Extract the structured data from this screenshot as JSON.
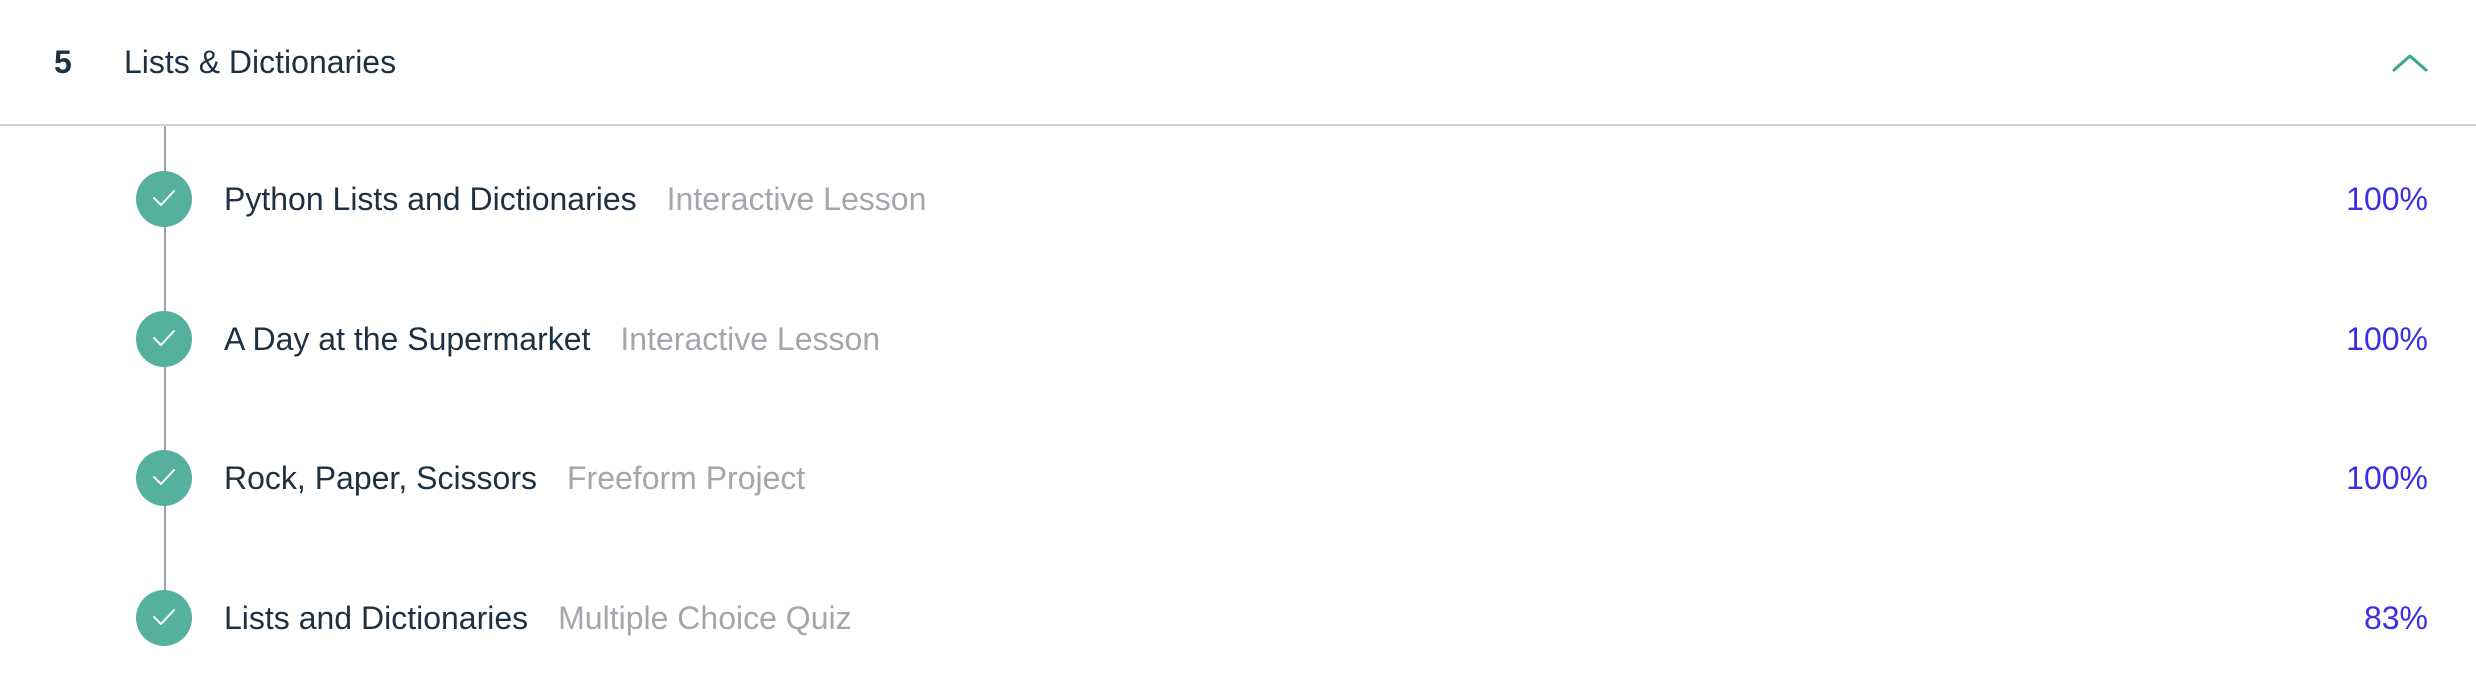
{
  "section": {
    "number": "5",
    "title": "Lists & Dictionaries",
    "toggle_icon": "chevron-up-icon",
    "accent_color": "#3aa394"
  },
  "items": [
    {
      "title": "Python Lists and Dictionaries",
      "type": "Interactive Lesson",
      "percent": "100%",
      "status_icon": "check-circle-icon"
    },
    {
      "title": "A Day at the Supermarket",
      "type": "Interactive Lesson",
      "percent": "100%",
      "status_icon": "check-circle-icon"
    },
    {
      "title": "Rock, Paper, Scissors",
      "type": "Freeform Project",
      "percent": "100%",
      "status_icon": "check-circle-icon"
    },
    {
      "title": "Lists and Dictionaries",
      "type": "Multiple Choice Quiz",
      "percent": "83%",
      "status_icon": "check-circle-icon"
    }
  ],
  "colors": {
    "complete": "#55b0a0",
    "percent_text": "#3a2ee6",
    "muted_text": "#a3a7ab",
    "primary_text": "#1d3142"
  }
}
